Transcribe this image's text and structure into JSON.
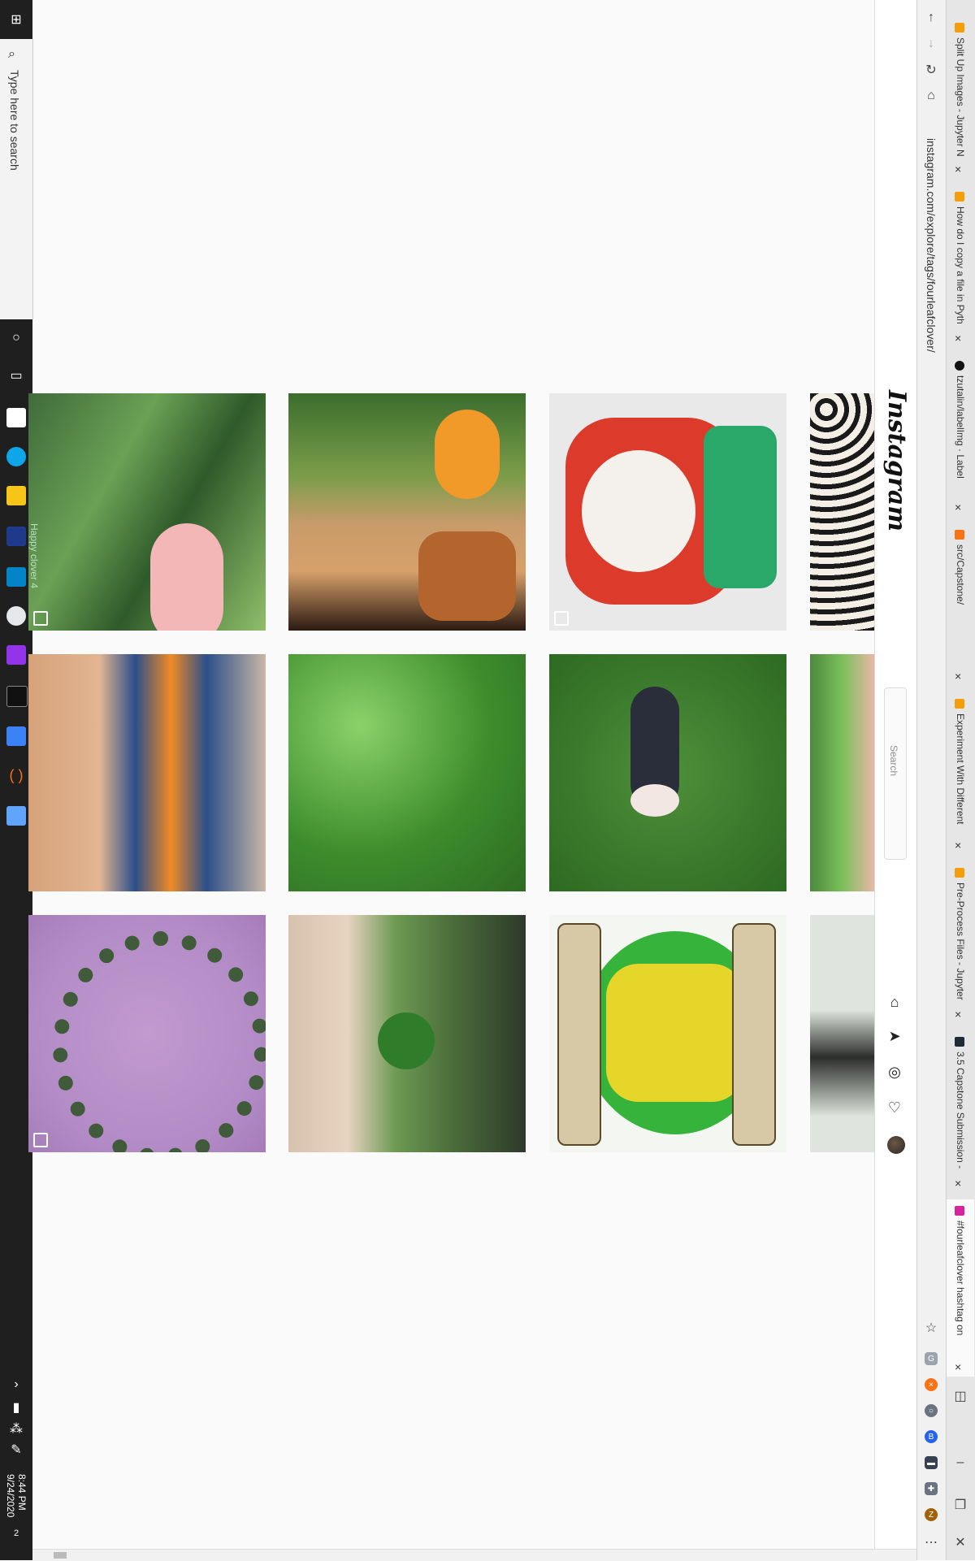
{
  "taskbar": {
    "search_placeholder": "Type here to search",
    "clock_time": "8:44 PM",
    "clock_date": "9/24/2020",
    "notification_count": "2"
  },
  "browser": {
    "url": "instagram.com/explore/tags/fourleafclover/",
    "tabs": [
      {
        "label": "Split Up Images - Jupyter N",
        "color": "#f59e0b"
      },
      {
        "label": "How do I copy a file in Pyth",
        "color": "#f59e0b"
      },
      {
        "label": "tzutalin/labelImg · Label",
        "color": "#111111"
      },
      {
        "label": "src/Capstone/",
        "color": "#f97316"
      },
      {
        "label": "Experiment With Different",
        "color": "#f59e0b"
      },
      {
        "label": "Pre-Process Files - Jupyter",
        "color": "#f59e0b"
      },
      {
        "label": "3.5 Capstone Submission -",
        "color": "#1f2937"
      },
      {
        "label": "#fourleafclover hashtag on",
        "color": "#d6249f"
      }
    ]
  },
  "instagram": {
    "logo": "Instagram",
    "search_placeholder": "Search"
  },
  "grid": {
    "overlay_text": "Happy clover 4"
  },
  "colors": {
    "ig_border": "#dbdbdb",
    "taskbar_bg": "#1f1f1f",
    "page_bg": "#fafafa"
  }
}
